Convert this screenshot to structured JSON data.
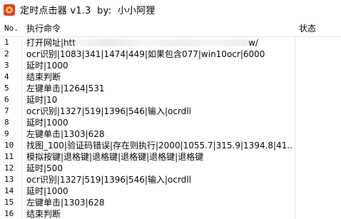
{
  "window": {
    "title": "定时点击器 v1.3  by:  小小阿狸",
    "icon": "app-logo-icon"
  },
  "table": {
    "headers": {
      "no": "No.",
      "command": "执行命令",
      "status": "状态"
    },
    "rows": [
      {
        "no": "1",
        "command_prefix": "打开网址|htt",
        "command_suffix": "w/",
        "redacted": true,
        "status": ""
      },
      {
        "no": "2",
        "command": "ocr识别|1083|341|1474|449|如果包含077|win10ocr|6000",
        "status": ""
      },
      {
        "no": "3",
        "command": "延时|1000",
        "status": ""
      },
      {
        "no": "4",
        "command": "结束判断",
        "status": ""
      },
      {
        "no": "5",
        "command": "左键单击|1264|531",
        "status": ""
      },
      {
        "no": "6",
        "command": "延时|10",
        "status": ""
      },
      {
        "no": "7",
        "command": "ocr识别|1327|519|1396|546|输入|ocrdll",
        "status": ""
      },
      {
        "no": "8",
        "command": "延时|1000",
        "status": ""
      },
      {
        "no": "9",
        "command": "左键单击|1303|628",
        "status": ""
      },
      {
        "no": "10",
        "command": "找图_100|验证码错误|存在则执行|2000|1055.7|315.9|1394.8|41...",
        "status": ""
      },
      {
        "no": "11",
        "command": "模拟按键|退格键|退格键|退格键|退格键|退格键",
        "status": ""
      },
      {
        "no": "12",
        "command": "延时|500",
        "status": ""
      },
      {
        "no": "13",
        "command": "ocr识别|1327|519|1396|546|输入|ocrdll",
        "status": ""
      },
      {
        "no": "14",
        "command": "延时|1000",
        "status": ""
      },
      {
        "no": "15",
        "command": "左键单击|1303|628",
        "status": ""
      },
      {
        "no": "16",
        "command": "结束判断",
        "status": ""
      }
    ]
  }
}
